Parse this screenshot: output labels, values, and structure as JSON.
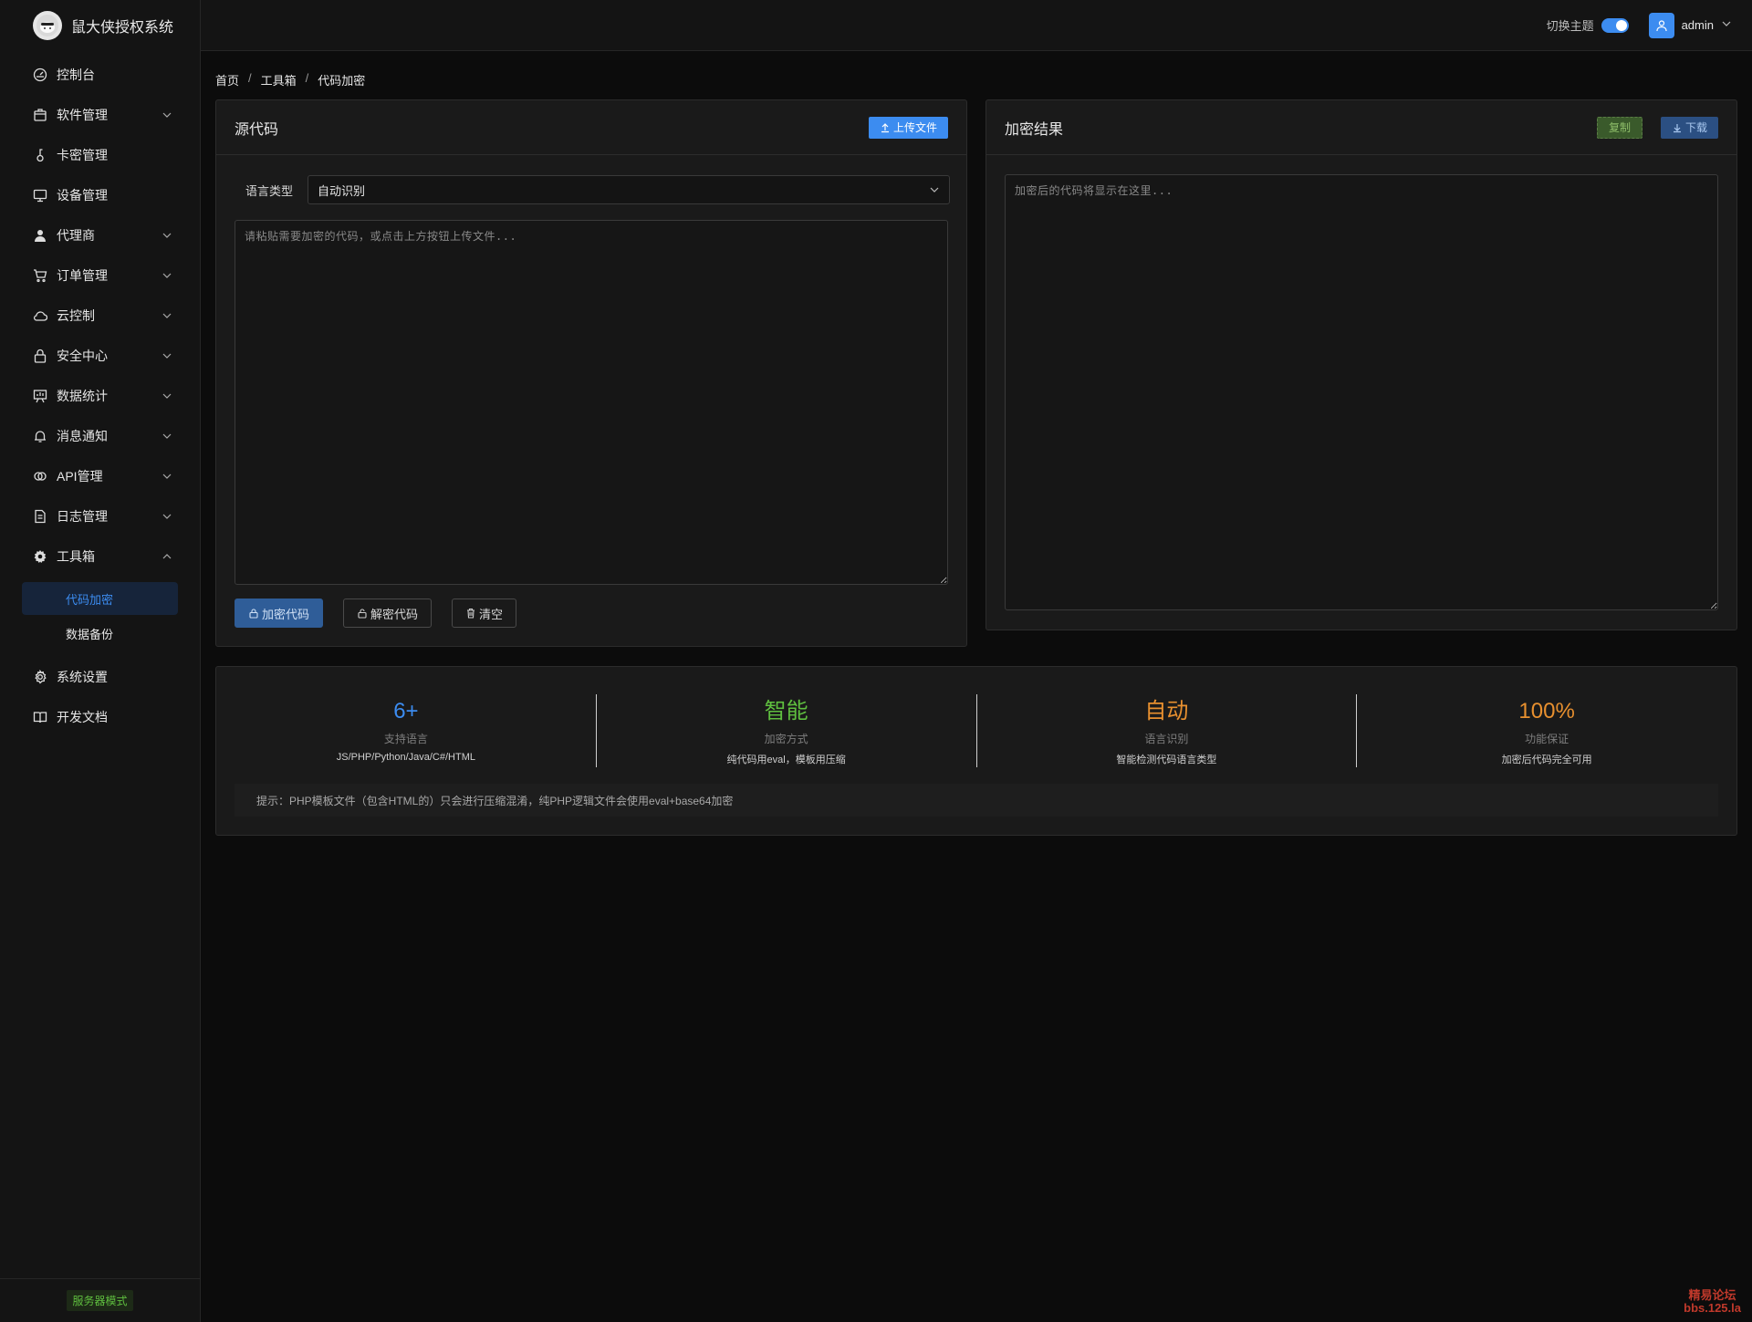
{
  "app": {
    "title": "鼠大侠授权系统"
  },
  "sidebar": {
    "items": [
      {
        "label": "控制台",
        "icon": "dashboard-icon",
        "expandable": false
      },
      {
        "label": "软件管理",
        "icon": "package-icon",
        "expandable": true
      },
      {
        "label": "卡密管理",
        "icon": "key-icon",
        "expandable": false
      },
      {
        "label": "设备管理",
        "icon": "monitor-icon",
        "expandable": false
      },
      {
        "label": "代理商",
        "icon": "user-icon",
        "expandable": true
      },
      {
        "label": "订单管理",
        "icon": "cart-icon",
        "expandable": true
      },
      {
        "label": "云控制",
        "icon": "cloud-icon",
        "expandable": true
      },
      {
        "label": "安全中心",
        "icon": "lock-icon",
        "expandable": true
      },
      {
        "label": "数据统计",
        "icon": "chart-board-icon",
        "expandable": true
      },
      {
        "label": "消息通知",
        "icon": "bell-icon",
        "expandable": true
      },
      {
        "label": "API管理",
        "icon": "api-link-icon",
        "expandable": true
      },
      {
        "label": "日志管理",
        "icon": "document-icon",
        "expandable": true
      },
      {
        "label": "工具箱",
        "icon": "gear-icon",
        "expandable": true,
        "expanded": true
      }
    ],
    "toolbox_sub": [
      {
        "label": "代码加密",
        "active": true
      },
      {
        "label": "数据备份",
        "active": false
      }
    ],
    "bottom_items": [
      {
        "label": "系统设置",
        "icon": "settings-icon"
      },
      {
        "label": "开发文档",
        "icon": "book-icon"
      }
    ],
    "footer_badge": "服务器模式"
  },
  "header": {
    "theme_label": "切换主题",
    "theme_toggle_on": true,
    "username": "admin"
  },
  "breadcrumb": [
    "首页",
    "工具箱",
    "代码加密"
  ],
  "source_panel": {
    "title": "源代码",
    "upload_label": "上传文件",
    "lang_label": "语言类型",
    "lang_value": "自动识别",
    "textarea_placeholder": "请粘贴需要加密的代码，或点击上方按钮上传文件...",
    "encrypt_label": "加密代码",
    "decrypt_label": "解密代码",
    "clear_label": "清空"
  },
  "result_panel": {
    "title": "加密结果",
    "copy_label": "复制",
    "download_label": "下载",
    "textarea_placeholder": "加密后的代码将显示在这里..."
  },
  "stats": [
    {
      "value": "6+",
      "label": "支持语言",
      "desc": "JS/PHP/Python/Java/C#/HTML",
      "color": "#3c8cf0"
    },
    {
      "value": "智能",
      "label": "加密方式",
      "desc": "纯代码用eval，模板用压缩",
      "color": "#5fbf3f"
    },
    {
      "value": "自动",
      "label": "语言识别",
      "desc": "智能检测代码语言类型",
      "color": "#e8902f"
    },
    {
      "value": "100%",
      "label": "功能保证",
      "desc": "加密后代码完全可用",
      "color": "#e8902f"
    }
  ],
  "tip": "提示：PHP模板文件（包含HTML的）只会进行压缩混淆，纯PHP逻辑文件会使用eval+base64加密",
  "watermark": [
    "精易论坛",
    "bbs.125.la"
  ],
  "colors": {
    "accent": "#3c8cf0",
    "success": "#5fbf3f",
    "warning": "#e8902f"
  }
}
